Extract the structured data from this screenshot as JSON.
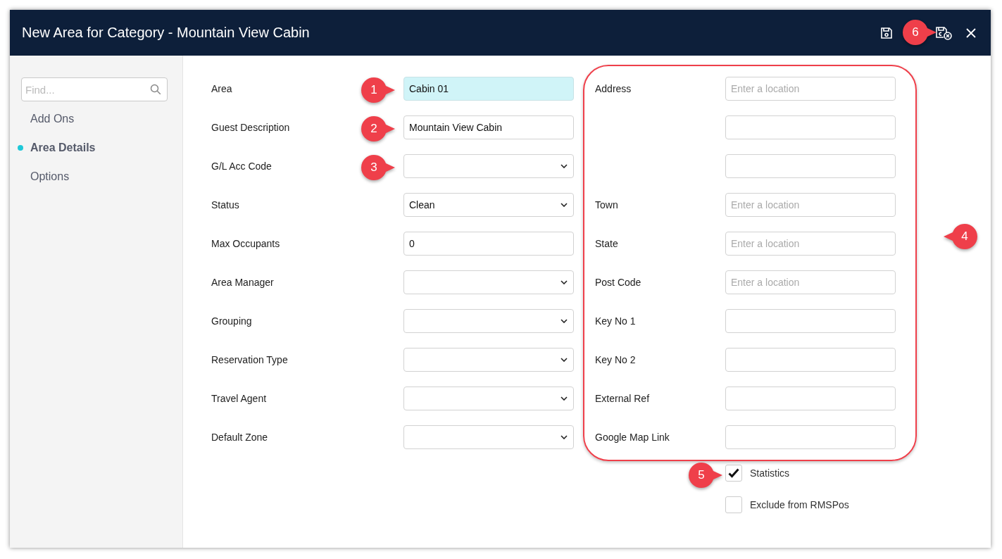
{
  "window": {
    "title": "New Area for Category - Mountain View Cabin"
  },
  "sidebar": {
    "search": {
      "placeholder": "Find..."
    },
    "items": [
      {
        "label": "Add Ons",
        "selected": false
      },
      {
        "label": "Area Details",
        "selected": true
      },
      {
        "label": "Options",
        "selected": false
      }
    ]
  },
  "left_fields": [
    {
      "label": "Area",
      "kind": "text",
      "value": "Cabin 01",
      "focused": true
    },
    {
      "label": "Guest Description",
      "kind": "text",
      "value": "Mountain View Cabin",
      "focused": false
    },
    {
      "label": "G/L Acc Code",
      "kind": "select",
      "focused": false
    },
    {
      "label": "Status",
      "kind": "select",
      "value": "Clean",
      "focused": false
    },
    {
      "label": "Max Occupants",
      "kind": "text",
      "value": "0",
      "focused": false
    },
    {
      "label": "Area Manager",
      "kind": "select",
      "focused": false
    },
    {
      "label": "Grouping",
      "kind": "select",
      "focused": false
    },
    {
      "label": "Reservation Type",
      "kind": "select",
      "focused": false
    },
    {
      "label": "Travel Agent",
      "kind": "select",
      "focused": false
    },
    {
      "label": "Default Zone",
      "kind": "select",
      "focused": false
    }
  ],
  "right_fields": [
    {
      "kind": "labeled",
      "label": "Address",
      "placeholder": "Enter a location"
    },
    {
      "kind": "address_line"
    },
    {
      "kind": "address_line"
    },
    {
      "kind": "labeled",
      "label": "Town",
      "placeholder": "Enter a location"
    },
    {
      "kind": "labeled",
      "label": "State",
      "placeholder": "Enter a location"
    },
    {
      "kind": "labeled",
      "label": "Post Code",
      "placeholder": "Enter a location"
    },
    {
      "kind": "labeled",
      "label": "Key No 1"
    },
    {
      "kind": "labeled",
      "label": "Key No 2"
    },
    {
      "kind": "labeled",
      "label": "External Ref"
    },
    {
      "kind": "labeled",
      "label": "Google Map Link"
    }
  ],
  "checkboxes": [
    {
      "label": "Statistics",
      "checked": true
    },
    {
      "label": "Exclude from RMSPos",
      "checked": false
    }
  ],
  "callouts": [
    "1",
    "2",
    "3",
    "4",
    "5",
    "6"
  ]
}
